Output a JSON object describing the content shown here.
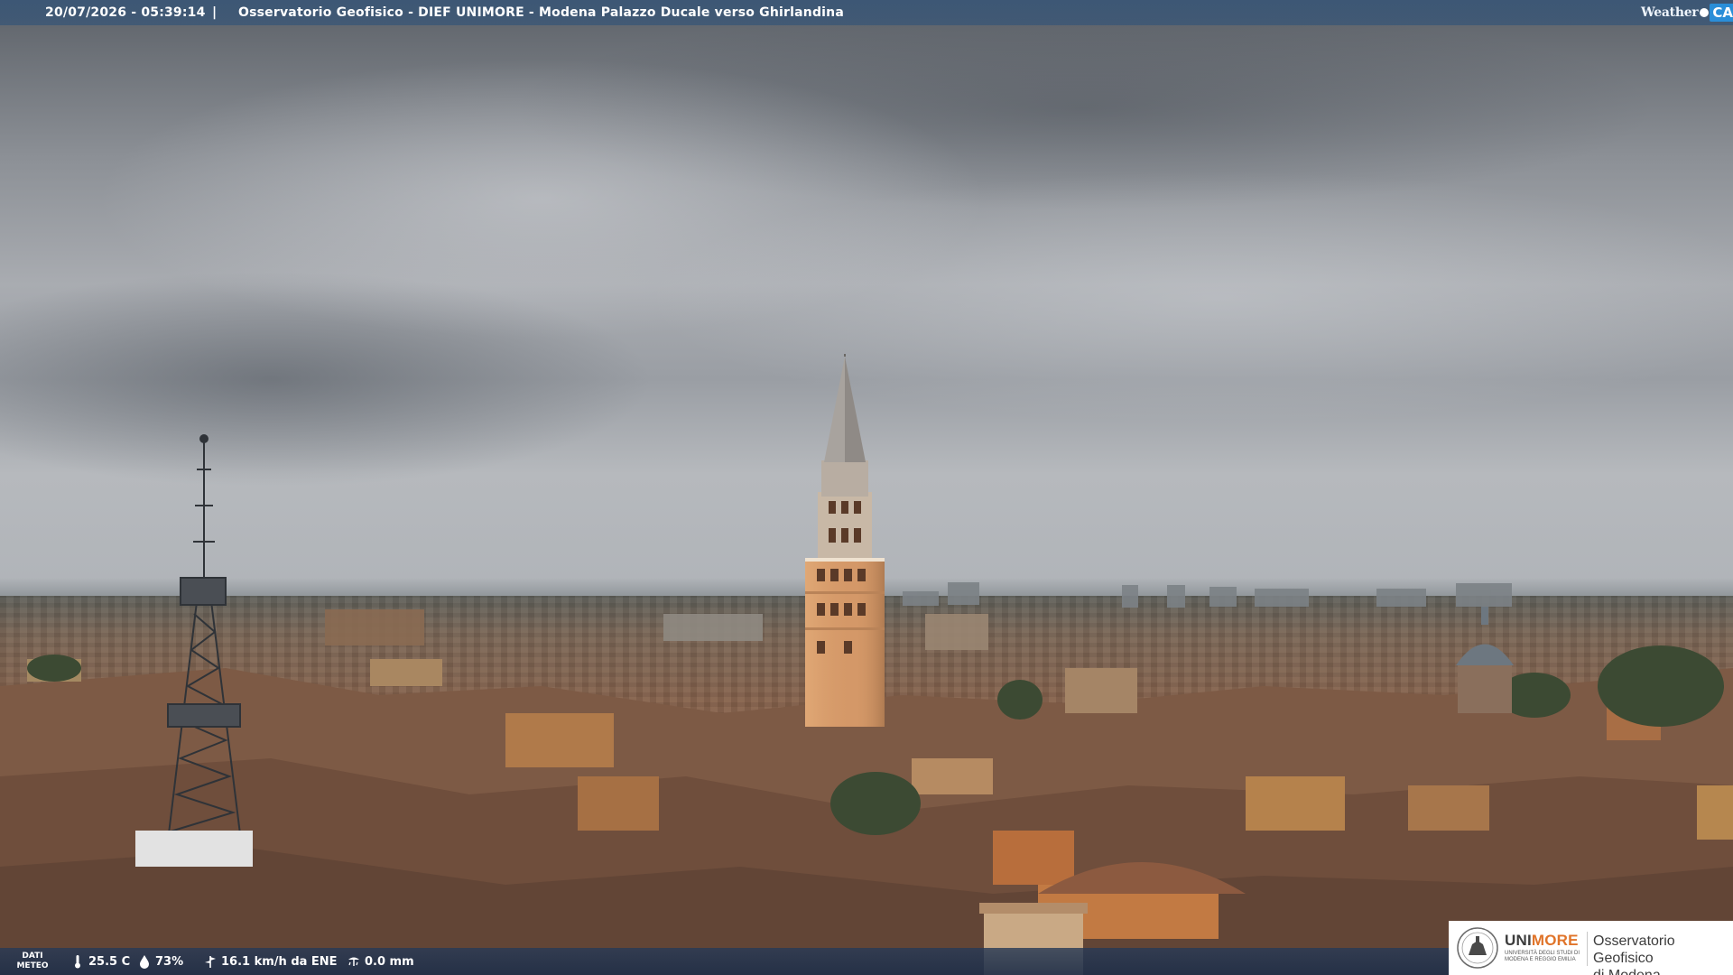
{
  "overlay": {
    "datetime": "20/07/2026 - 05:39:14",
    "separator": "|",
    "title": "Osservatorio Geofisico - DIEF UNIMORE - Modena Palazzo Ducale verso Ghirlandina"
  },
  "brand_logo": {
    "weather_text": "Weather",
    "cam_text": "CAM",
    "accent_color": "#2a8ed8"
  },
  "weather_strip": {
    "label_line1": "DATI",
    "label_line2": "METEO",
    "temperature": "25.5 C",
    "temperature_icon": "thermometer-icon",
    "humidity": "73%",
    "humidity_icon": "droplet-icon",
    "wind": "16.1 km/h da ENE",
    "wind_icon": "wind-icon",
    "rain": "0.0 mm",
    "rain_icon": "rain-gauge-icon"
  },
  "institution_logo": {
    "name_part1": "UNI",
    "name_part2": "MORE",
    "subtitle": "UNIVERSITÀ DEGLI STUDI DI MODENA E REGGIO EMILIA",
    "observatory_line1": "Osservatorio Geofisico",
    "observatory_line2": "di Modena",
    "accent_color": "#e0742a"
  },
  "scene": {
    "description_icons": [
      "bell-tower",
      "antenna-mast",
      "dome",
      "rooftops",
      "overcast-sky"
    ]
  }
}
